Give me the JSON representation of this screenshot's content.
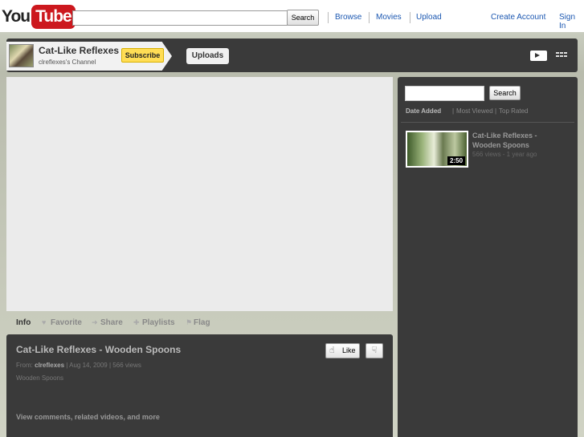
{
  "masthead": {
    "logo_you": "You",
    "logo_tube": "Tube",
    "search_button": "Search",
    "nav": [
      "Browse",
      "Movies",
      "Upload"
    ],
    "create_account": "Create Account",
    "sign_in": "Sign In"
  },
  "channel": {
    "title": "Cat-Like Reflexes",
    "subtitle": "clreflexes's Channel",
    "subscribe": "Subscribe",
    "uploads": "Uploads"
  },
  "actions": {
    "info": "Info",
    "favorite": "Favorite",
    "share": "Share",
    "playlists": "Playlists",
    "flag": "Flag"
  },
  "video": {
    "title": "Cat-Like Reflexes - Wooden Spoons",
    "from_label": "From:",
    "from_user": "clreflexes",
    "date": "Aug 14, 2009",
    "views": "566 views",
    "description": "Wooden Spoons",
    "more_link": "View comments, related videos, and more",
    "like": "Like"
  },
  "sidebar": {
    "search_button": "Search",
    "sort": {
      "date_added": "Date Added",
      "most_viewed": "Most Viewed",
      "top_rated": "Top Rated"
    },
    "item": {
      "title": "Cat-Like Reflexes - Wooden Spoons",
      "meta": "566 views - 1 year ago",
      "duration": "2:50"
    }
  },
  "colors": {
    "brand_red": "#cc181e",
    "link_blue": "#1b57b1",
    "subscribe_yellow": "#ffdd55",
    "panel_dark": "#3a3a3a"
  },
  "icons": [
    "thumbs-up-icon",
    "thumbs-down-icon",
    "heart-icon",
    "share-arrow-icon",
    "plus-icon",
    "flag-icon",
    "player-view-icon",
    "grid-view-icon"
  ]
}
